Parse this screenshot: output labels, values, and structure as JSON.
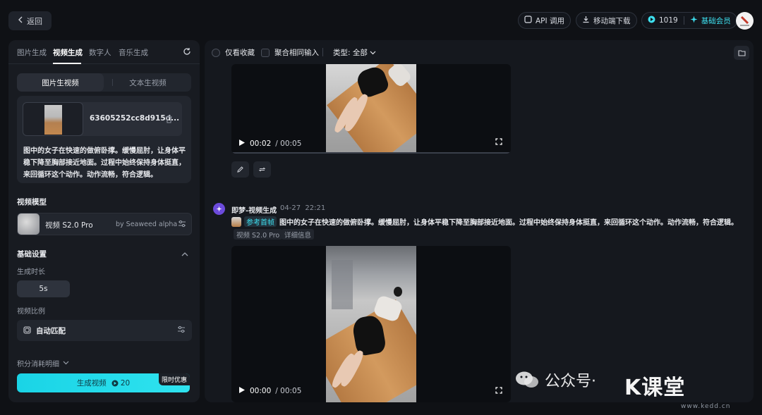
{
  "topbar": {
    "back_label": "返回",
    "api_label": "API 调用",
    "mobile_download_label": "移动端下载",
    "credits_value": "1019",
    "member_label": "基础会员"
  },
  "left": {
    "tabs": [
      "图片生成",
      "视频生成",
      "数字人",
      "音乐生成"
    ],
    "mode_tabs": [
      "图片生视频",
      "文本生视频"
    ],
    "file_name": "63605252cc8d915d...",
    "prompt": "图中的女子在快速的做俯卧撑。缓慢屈肘，让身体平稳下降至胸部接近地面。过程中始终保持身体挺直，来回循环这个动作。动作流畅，符合逻辑。",
    "model_section": "视频模型",
    "model_name": "视频 S2.0 Pro",
    "model_by": "by Seaweed alpha",
    "basic_settings": "基础设置",
    "duration_label": "生成时长",
    "duration_value": "5s",
    "ratio_label": "视频比例",
    "ratio_value": "自动匹配",
    "points_detail": "积分消耗明细",
    "generate_label": "生成视频",
    "generate_cost": "20",
    "limited_badge": "限时优惠"
  },
  "right": {
    "filter_favorites": "仅看收藏",
    "filter_aggregate": "聚合相同输入",
    "filter_type": "类型: 全部",
    "video1_time": "00:02",
    "video1_total": "/ 00:05",
    "message": {
      "title": "即梦-视频生成",
      "date": "04-27",
      "time": "22:21",
      "ref_label": "参考首帧",
      "text": "图中的女子在快速的做俯卧撑。缓慢屈肘，让身体平稳下降至胸部接近地面。过程中始终保持身体挺直，来回循环这个动作。动作流畅，符合逻辑。",
      "chips": [
        "视频 S2.0 Pro",
        "详细信息"
      ]
    },
    "video2_time": "00:00",
    "video2_total": "/ 00:05"
  },
  "watermark": {
    "text": "公众号·",
    "logo": "K课堂",
    "url": "www.kedd.cn"
  }
}
